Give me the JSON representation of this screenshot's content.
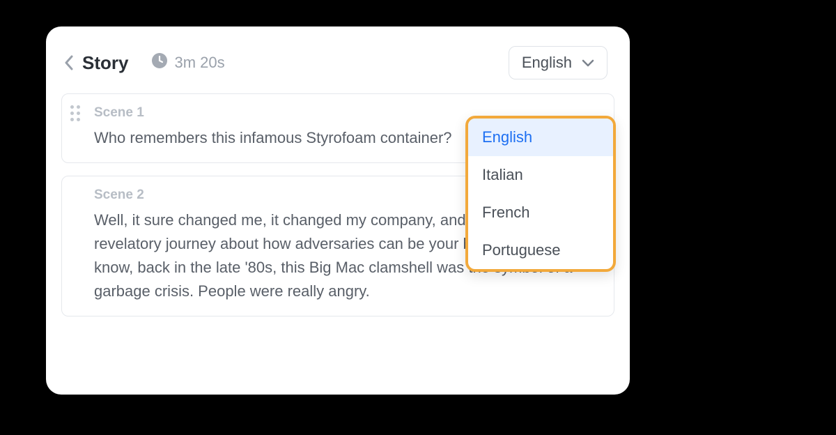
{
  "header": {
    "title": "Story",
    "duration": "3m 20s",
    "language_selected": "English"
  },
  "scenes": [
    {
      "label": "Scene 1",
      "body": "Who remembers this infamous Styrofoam container?"
    },
    {
      "label": "Scene 2",
      "body": "Well, it sure changed me, it changed my company, and it started a revelatory journey about how adversaries can be your best allies.   You know, back in the late '80s, this Big Mac clamshell was the symbol of a garbage crisis. People were really angry."
    }
  ],
  "language_options": [
    "English",
    "Italian",
    "French",
    "Portuguese"
  ]
}
